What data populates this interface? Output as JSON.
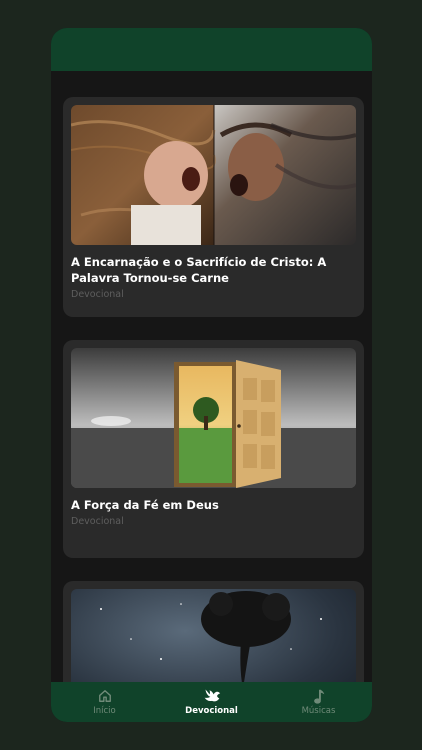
{
  "feed": {
    "posts": [
      {
        "title": "A Encarnação e o Sacrifício de Cristo: A Palavra Tornou-se Carne",
        "category": "Devocional",
        "image": "child-and-christ-crown-of-thorns"
      },
      {
        "title": "A Força da Fé em Deus",
        "category": "Devocional",
        "image": "open-door-to-green-field"
      },
      {
        "title": "",
        "category": "",
        "image": "tree-reflection-night-sky"
      }
    ]
  },
  "nav": {
    "items": [
      {
        "label": "Início",
        "icon": "home-icon",
        "active": false
      },
      {
        "label": "Devocional",
        "icon": "dove-icon",
        "active": true
      },
      {
        "label": "Músicas",
        "icon": "music-note-icon",
        "active": false
      }
    ]
  },
  "colors": {
    "background": "#1c261e",
    "header": "#10432a",
    "card": "#2a2a2a",
    "active_label": "#ffffff",
    "inactive_label": "#6f8a78"
  }
}
